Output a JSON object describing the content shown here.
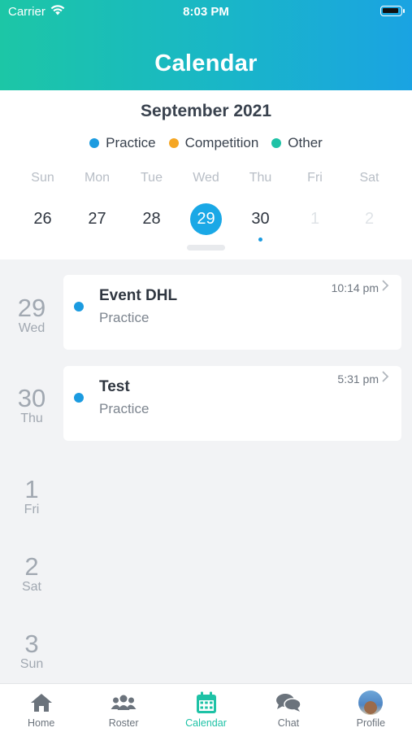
{
  "status_bar": {
    "carrier": "Carrier",
    "time": "8:03 PM"
  },
  "header": {
    "title": "Calendar"
  },
  "calendar": {
    "month": "September 2021",
    "legend": [
      {
        "label": "Practice",
        "color": "#1b9be0"
      },
      {
        "label": "Competition",
        "color": "#f5a623"
      },
      {
        "label": "Other",
        "color": "#1ec2a6"
      }
    ],
    "days": [
      {
        "dow": "Sun",
        "num": "26"
      },
      {
        "dow": "Mon",
        "num": "27"
      },
      {
        "dow": "Tue",
        "num": "28"
      },
      {
        "dow": "Wed",
        "num": "29",
        "selected": true
      },
      {
        "dow": "Thu",
        "num": "30",
        "has_event": true
      },
      {
        "dow": "Fri",
        "num": "1",
        "other_month": true
      },
      {
        "dow": "Sat",
        "num": "2",
        "other_month": true
      }
    ]
  },
  "agenda": [
    {
      "num": "29",
      "dow": "Wed",
      "event": {
        "title": "Event DHL",
        "category": "Practice",
        "time": "10:14 pm"
      }
    },
    {
      "num": "30",
      "dow": "Thu",
      "event": {
        "title": "Test",
        "category": "Practice",
        "time": "5:31 pm"
      }
    },
    {
      "num": "1",
      "dow": "Fri"
    },
    {
      "num": "2",
      "dow": "Sat"
    },
    {
      "num": "3",
      "dow": "Sun"
    }
  ],
  "tabs": [
    {
      "label": "Home",
      "icon": "home-icon"
    },
    {
      "label": "Roster",
      "icon": "roster-icon"
    },
    {
      "label": "Calendar",
      "icon": "calendar-icon",
      "active": true
    },
    {
      "label": "Chat",
      "icon": "chat-icon"
    },
    {
      "label": "Profile",
      "icon": "avatar"
    }
  ],
  "colors": {
    "accent": "#1ec2a6",
    "selected_day": "#1aa8e6",
    "practice": "#1b9be0"
  }
}
